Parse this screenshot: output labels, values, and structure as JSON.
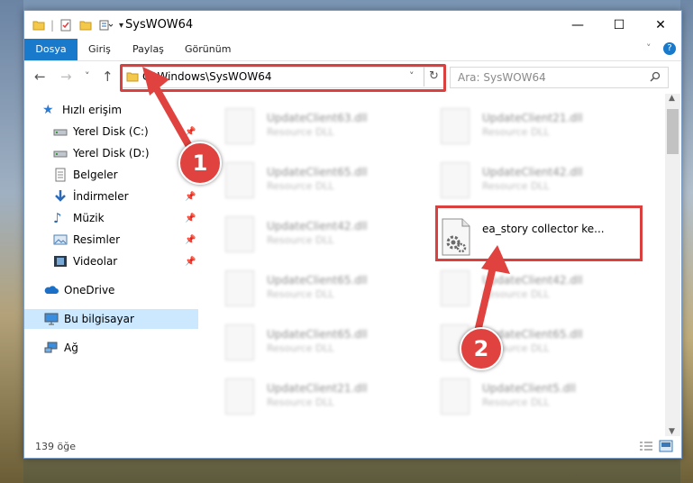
{
  "window": {
    "title": "SysWOW64",
    "minimize": "—",
    "maximize": "☐",
    "close": "✕"
  },
  "ribbon": {
    "tabs": [
      "Dosya",
      "Giriş",
      "Paylaş",
      "Görünüm"
    ]
  },
  "nav": {
    "back": "←",
    "forward": "→",
    "recent": "˅",
    "up": "↑",
    "address": "C:\\Windows\\SysWOW64",
    "search_placeholder": "Ara: SysWOW64"
  },
  "sidebar": {
    "items": [
      {
        "label": "Hızlı erişim",
        "icon": "star-icon"
      },
      {
        "label": "Yerel Disk (C:)",
        "icon": "drive-icon"
      },
      {
        "label": "Yerel Disk (D:)",
        "icon": "drive-icon"
      },
      {
        "label": "Belgeler",
        "icon": "documents-icon"
      },
      {
        "label": "İndirmeler",
        "icon": "download-icon"
      },
      {
        "label": "Müzik",
        "icon": "music-icon"
      },
      {
        "label": "Resimler",
        "icon": "pictures-icon"
      },
      {
        "label": "Videolar",
        "icon": "video-icon"
      },
      {
        "label": "OneDrive",
        "icon": "cloud-icon"
      },
      {
        "label": "Bu bilgisayar",
        "icon": "computer-icon"
      },
      {
        "label": "Ağ",
        "icon": "network-icon"
      }
    ]
  },
  "files": {
    "left": [
      {
        "name": "UpdateClient63.dll",
        "type": "Resource DLL"
      },
      {
        "name": "UpdateClient65.dll",
        "type": "Resource DLL"
      },
      {
        "name": "UpdateClient42.dll",
        "type": "Resource DLL"
      },
      {
        "name": "UpdateClient65.dll",
        "type": "Resource DLL"
      },
      {
        "name": "UpdateClient65.dll",
        "type": "Resource DLL"
      },
      {
        "name": "UpdateClient21.dll",
        "type": "Resource DLL"
      }
    ],
    "right": [
      {
        "name": "UpdateClient21.dll",
        "type": "Resource DLL"
      },
      {
        "name": "UpdateClient42.dll",
        "type": "Resource DLL"
      },
      {
        "name": "UpdateClient42.dll",
        "type": "Resource DLL"
      },
      {
        "name": "UpdateClient65.dll",
        "type": "Resource DLL"
      },
      {
        "name": "UpdateClient5.dll",
        "type": "Resource DLL"
      }
    ],
    "highlighted": {
      "name": "ea_story collector ke..."
    }
  },
  "status": {
    "count": "139 öğe"
  },
  "annotations": {
    "badge1": "1",
    "badge2": "2",
    "accent": "#e0433f"
  }
}
